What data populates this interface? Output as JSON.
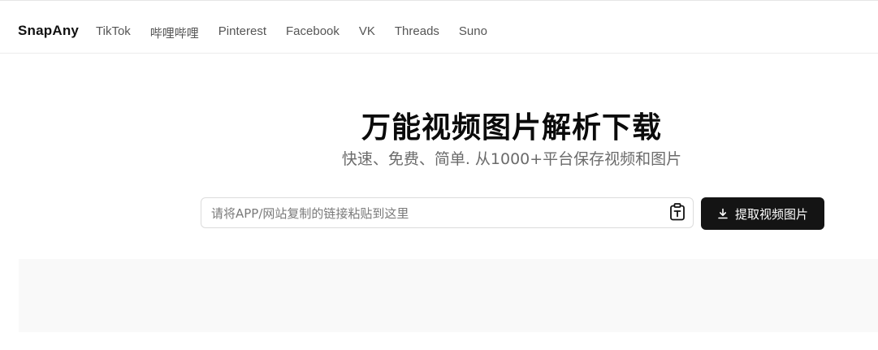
{
  "header": {
    "brand": "SnapAny",
    "nav": [
      {
        "label": "TikTok"
      },
      {
        "label": "哔哩哔哩"
      },
      {
        "label": "Pinterest"
      },
      {
        "label": "Facebook"
      },
      {
        "label": "VK"
      },
      {
        "label": "Threads"
      },
      {
        "label": "Suno"
      }
    ]
  },
  "hero": {
    "title": "万能视频图片解析下载",
    "subtitle": "快速、免费、简单. 从1000+平台保存视频和图片"
  },
  "search": {
    "placeholder": "请将APP/网站复制的链接粘贴到这里",
    "value": "",
    "paste_icon": "clipboard-text-icon",
    "button_label": "提取视频图片",
    "button_icon": "download-icon"
  },
  "colors": {
    "button_bg": "#141414",
    "panel_bg": "#f9f9f9",
    "nav_text": "#555555",
    "subtitle_text": "#6b6b6b"
  }
}
